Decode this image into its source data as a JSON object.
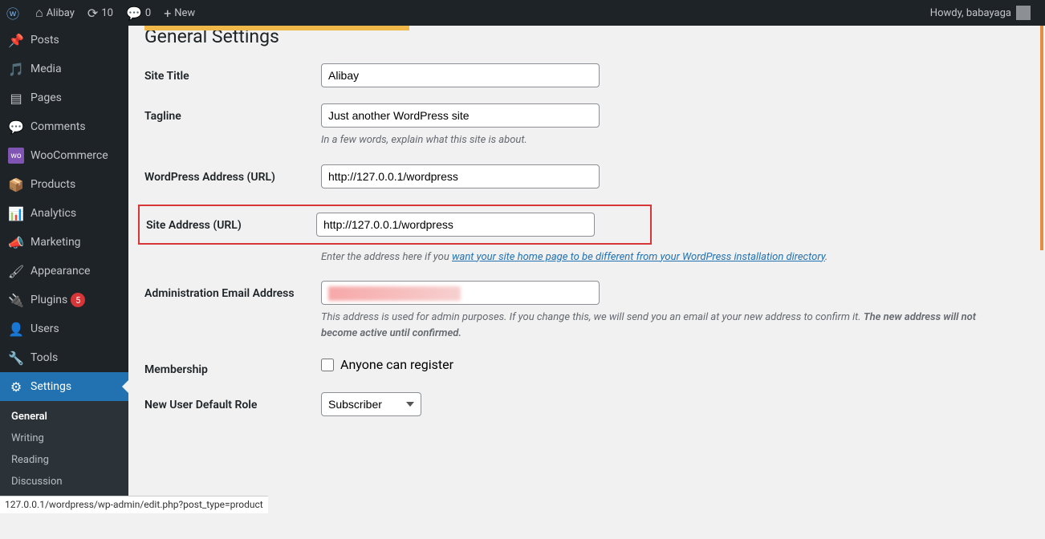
{
  "adminbar": {
    "site_name": "Alibay",
    "updates_count": "10",
    "comments_count": "0",
    "new_label": "New",
    "howdy": "Howdy, babayaga"
  },
  "sidebar": {
    "items": [
      {
        "label": "Posts"
      },
      {
        "label": "Media"
      },
      {
        "label": "Pages"
      },
      {
        "label": "Comments"
      },
      {
        "label": "WooCommerce"
      },
      {
        "label": "Products"
      },
      {
        "label": "Analytics"
      },
      {
        "label": "Marketing"
      },
      {
        "label": "Appearance"
      },
      {
        "label": "Plugins",
        "badge": "5"
      },
      {
        "label": "Users"
      },
      {
        "label": "Tools"
      },
      {
        "label": "Settings"
      }
    ],
    "settings_submenu": [
      {
        "label": "General"
      },
      {
        "label": "Writing"
      },
      {
        "label": "Reading"
      },
      {
        "label": "Discussion"
      }
    ]
  },
  "page": {
    "title": "General Settings",
    "fields": {
      "site_title": {
        "label": "Site Title",
        "value": "Alibay"
      },
      "tagline": {
        "label": "Tagline",
        "value": "Just another WordPress site",
        "desc": "In a few words, explain what this site is about."
      },
      "wp_url": {
        "label": "WordPress Address (URL)",
        "value": "http://127.0.0.1/wordpress"
      },
      "site_url": {
        "label": "Site Address (URL)",
        "value": "http://127.0.0.1/wordpress",
        "desc_prefix": "Enter the address here if you ",
        "desc_link": "want your site home page to be different from your WordPress installation directory"
      },
      "admin_email": {
        "label": "Administration Email Address",
        "desc_prefix": "This address is used for admin purposes. If you change this, we will send you an email at your new address to confirm it. ",
        "desc_strong": "The new address will not become active until confirmed."
      },
      "membership": {
        "label": "Membership",
        "checkbox_label": "Anyone can register"
      },
      "default_role": {
        "label": "New User Default Role",
        "value": "Subscriber"
      }
    }
  },
  "statusbar": "127.0.0.1/wordpress/wp-admin/edit.php?post_type=product"
}
